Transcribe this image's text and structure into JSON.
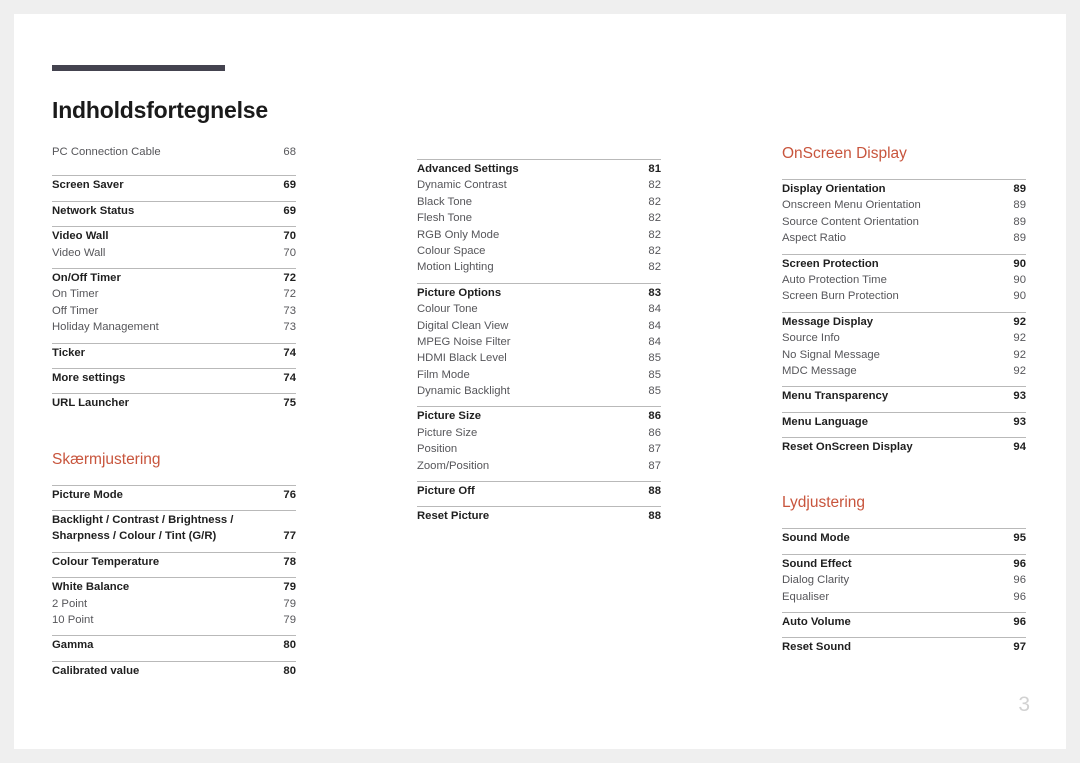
{
  "document": {
    "title": "Indholdsfortegnelse",
    "folio": "3"
  },
  "columns": [
    {
      "id": "column-1",
      "blocks": [
        {
          "type": "group",
          "rule": false,
          "rows": [
            {
              "kind": "sub",
              "label": "PC Connection Cable",
              "page": "68"
            }
          ]
        },
        {
          "type": "group",
          "rule": true,
          "rows": [
            {
              "kind": "head",
              "label": "Screen Saver",
              "page": "69"
            }
          ]
        },
        {
          "type": "group",
          "rule": true,
          "rows": [
            {
              "kind": "head",
              "label": "Network Status",
              "page": "69"
            }
          ]
        },
        {
          "type": "group",
          "rule": true,
          "rows": [
            {
              "kind": "head",
              "label": "Video Wall",
              "page": "70"
            },
            {
              "kind": "sub",
              "label": "Video Wall",
              "page": "70"
            }
          ]
        },
        {
          "type": "group",
          "rule": true,
          "rows": [
            {
              "kind": "head",
              "label": "On/Off Timer",
              "page": "72"
            },
            {
              "kind": "sub",
              "label": "On Timer",
              "page": "72"
            },
            {
              "kind": "sub",
              "label": "Off Timer",
              "page": "73"
            },
            {
              "kind": "sub",
              "label": "Holiday Management",
              "page": "73"
            }
          ]
        },
        {
          "type": "group",
          "rule": true,
          "rows": [
            {
              "kind": "head",
              "label": "Ticker",
              "page": "74"
            }
          ]
        },
        {
          "type": "group",
          "rule": true,
          "rows": [
            {
              "kind": "head",
              "label": "More settings",
              "page": "74"
            }
          ]
        },
        {
          "type": "group",
          "rule": true,
          "rows": [
            {
              "kind": "head",
              "label": "URL Launcher",
              "page": "75"
            }
          ]
        },
        {
          "type": "heading",
          "label": "Skærmjustering"
        },
        {
          "type": "group",
          "rule": true,
          "rows": [
            {
              "kind": "head",
              "label": "Picture Mode",
              "page": "76"
            }
          ]
        },
        {
          "type": "group",
          "rule": true,
          "rows": [
            {
              "kind": "head",
              "label": "Backlight / Contrast / Brightness / Sharpness / Colour / Tint (G/R)",
              "page": "77",
              "multiline": true
            }
          ]
        },
        {
          "type": "group",
          "rule": true,
          "rows": [
            {
              "kind": "head",
              "label": "Colour Temperature",
              "page": "78"
            }
          ]
        },
        {
          "type": "group",
          "rule": true,
          "rows": [
            {
              "kind": "head",
              "label": "White Balance",
              "page": "79"
            },
            {
              "kind": "sub",
              "label": "2 Point",
              "page": "79"
            },
            {
              "kind": "sub",
              "label": "10 Point",
              "page": "79"
            }
          ]
        },
        {
          "type": "group",
          "rule": true,
          "rows": [
            {
              "kind": "head",
              "label": "Gamma",
              "page": "80"
            }
          ]
        },
        {
          "type": "group",
          "rule": true,
          "rows": [
            {
              "kind": "head",
              "label": "Calibrated value",
              "page": "80"
            }
          ]
        }
      ]
    },
    {
      "id": "column-2",
      "blocks": [
        {
          "type": "group",
          "rule": true,
          "rows": [
            {
              "kind": "head",
              "label": "Advanced Settings",
              "page": "81"
            },
            {
              "kind": "sub",
              "label": "Dynamic Contrast",
              "page": "82"
            },
            {
              "kind": "sub",
              "label": "Black Tone",
              "page": "82"
            },
            {
              "kind": "sub",
              "label": "Flesh Tone",
              "page": "82"
            },
            {
              "kind": "sub",
              "label": "RGB Only Mode",
              "page": "82"
            },
            {
              "kind": "sub",
              "label": "Colour Space",
              "page": "82"
            },
            {
              "kind": "sub",
              "label": "Motion Lighting",
              "page": "82"
            }
          ]
        },
        {
          "type": "group",
          "rule": true,
          "rows": [
            {
              "kind": "head",
              "label": "Picture Options",
              "page": "83"
            },
            {
              "kind": "sub",
              "label": "Colour Tone",
              "page": "84"
            },
            {
              "kind": "sub",
              "label": "Digital Clean View",
              "page": "84"
            },
            {
              "kind": "sub",
              "label": "MPEG Noise Filter",
              "page": "84"
            },
            {
              "kind": "sub",
              "label": "HDMI Black Level",
              "page": "85"
            },
            {
              "kind": "sub",
              "label": "Film Mode",
              "page": "85"
            },
            {
              "kind": "sub",
              "label": "Dynamic Backlight",
              "page": "85"
            }
          ]
        },
        {
          "type": "group",
          "rule": true,
          "rows": [
            {
              "kind": "head",
              "label": "Picture Size",
              "page": "86"
            },
            {
              "kind": "sub",
              "label": "Picture Size",
              "page": "86"
            },
            {
              "kind": "sub",
              "label": "Position",
              "page": "87"
            },
            {
              "kind": "sub",
              "label": "Zoom/Position",
              "page": "87"
            }
          ]
        },
        {
          "type": "group",
          "rule": true,
          "rows": [
            {
              "kind": "head",
              "label": "Picture Off",
              "page": "88"
            }
          ]
        },
        {
          "type": "group",
          "rule": true,
          "rows": [
            {
              "kind": "head",
              "label": "Reset Picture",
              "page": "88"
            }
          ]
        }
      ]
    },
    {
      "id": "column-3",
      "blocks": [
        {
          "type": "heading",
          "label": "OnScreen Display",
          "first": true
        },
        {
          "type": "group",
          "rule": true,
          "rows": [
            {
              "kind": "head",
              "label": "Display Orientation",
              "page": "89"
            },
            {
              "kind": "sub",
              "label": "Onscreen Menu Orientation",
              "page": "89"
            },
            {
              "kind": "sub",
              "label": "Source Content Orientation",
              "page": "89"
            },
            {
              "kind": "sub",
              "label": "Aspect Ratio",
              "page": "89"
            }
          ]
        },
        {
          "type": "group",
          "rule": true,
          "rows": [
            {
              "kind": "head",
              "label": "Screen Protection",
              "page": "90"
            },
            {
              "kind": "sub",
              "label": "Auto Protection Time",
              "page": "90"
            },
            {
              "kind": "sub",
              "label": "Screen Burn Protection",
              "page": "90"
            }
          ]
        },
        {
          "type": "group",
          "rule": true,
          "rows": [
            {
              "kind": "head",
              "label": "Message Display",
              "page": "92"
            },
            {
              "kind": "sub",
              "label": "Source Info",
              "page": "92"
            },
            {
              "kind": "sub",
              "label": "No Signal Message",
              "page": "92"
            },
            {
              "kind": "sub",
              "label": "MDC Message",
              "page": "92"
            }
          ]
        },
        {
          "type": "group",
          "rule": true,
          "rows": [
            {
              "kind": "head",
              "label": "Menu Transparency",
              "page": "93"
            }
          ]
        },
        {
          "type": "group",
          "rule": true,
          "rows": [
            {
              "kind": "head",
              "label": "Menu Language",
              "page": "93"
            }
          ]
        },
        {
          "type": "group",
          "rule": true,
          "rows": [
            {
              "kind": "head",
              "label": "Reset OnScreen Display",
              "page": "94"
            }
          ]
        },
        {
          "type": "heading",
          "label": "Lydjustering"
        },
        {
          "type": "group",
          "rule": true,
          "rows": [
            {
              "kind": "head",
              "label": "Sound Mode",
              "page": "95"
            }
          ]
        },
        {
          "type": "group",
          "rule": true,
          "rows": [
            {
              "kind": "head",
              "label": "Sound Effect",
              "page": "96"
            },
            {
              "kind": "sub",
              "label": "Dialog Clarity",
              "page": "96"
            },
            {
              "kind": "sub",
              "label": "Equaliser",
              "page": "96"
            }
          ]
        },
        {
          "type": "group",
          "rule": true,
          "rows": [
            {
              "kind": "head",
              "label": "Auto Volume",
              "page": "96"
            }
          ]
        },
        {
          "type": "group",
          "rule": true,
          "rows": [
            {
              "kind": "head",
              "label": "Reset Sound",
              "page": "97"
            }
          ]
        }
      ]
    }
  ],
  "theme": {
    "accent": "#c8553d",
    "title_rule": "#44434f",
    "rule": "#b9b9b9",
    "folio": "#d2d2d2"
  }
}
